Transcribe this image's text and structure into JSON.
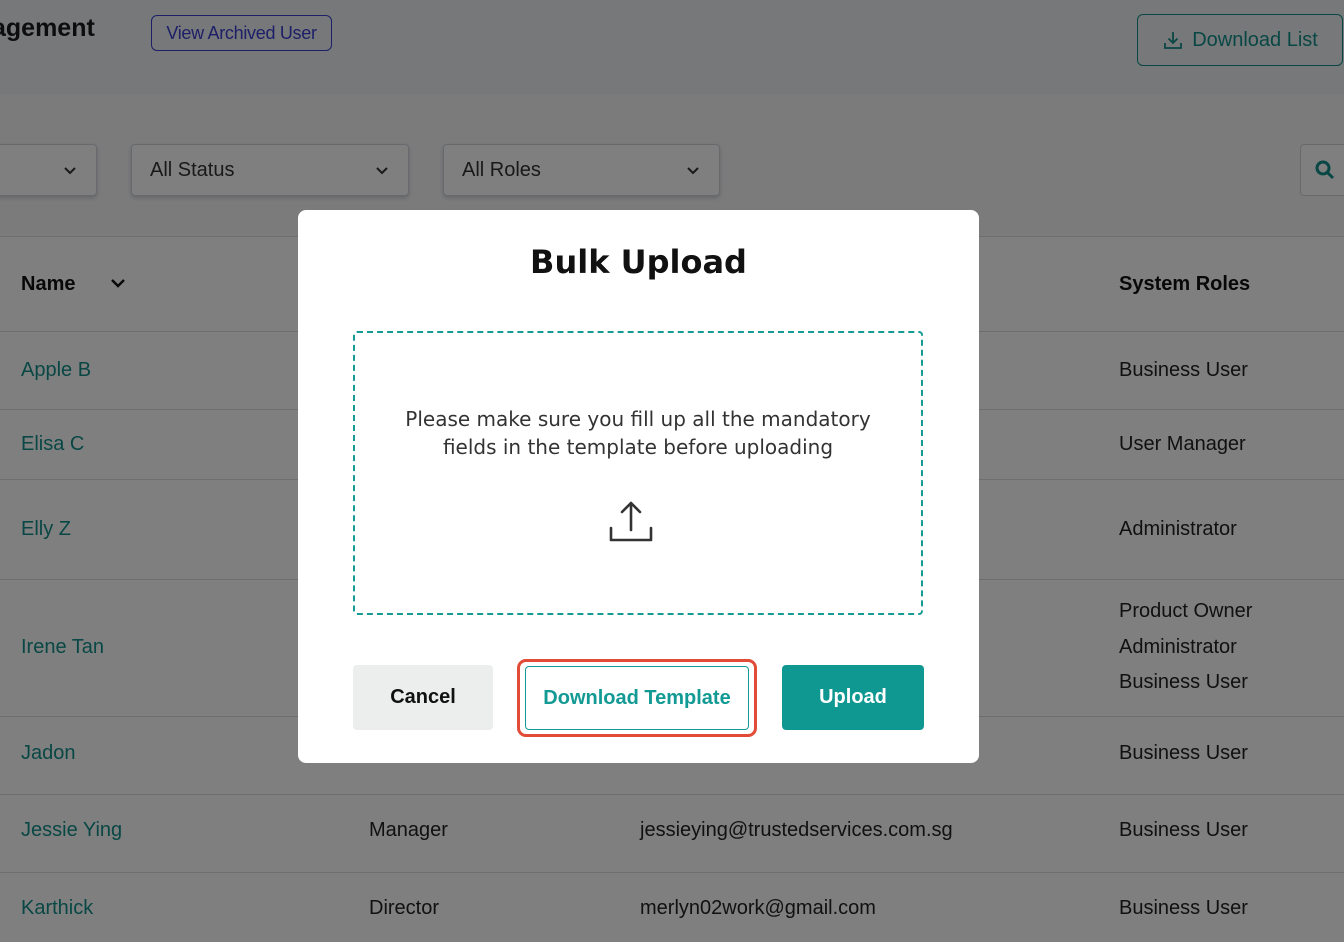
{
  "header": {
    "title_fragment": "agement",
    "view_archived_label": "View Archived User",
    "download_list_label": "Download List"
  },
  "filters": {
    "first_select_value": "",
    "status_select_value": "All Status",
    "roles_select_value": "All Roles"
  },
  "table": {
    "columns": {
      "name": "Name",
      "system_roles": "System Roles"
    },
    "rows": [
      {
        "name": "Apple B",
        "designation": "",
        "email": "",
        "roles": [
          "Business User"
        ]
      },
      {
        "name": "Elisa C",
        "designation": "",
        "email": "",
        "roles": [
          "User Manager"
        ]
      },
      {
        "name": "Elly Z",
        "designation": "",
        "email": "",
        "roles": [
          "Administrator"
        ]
      },
      {
        "name": "Irene Tan",
        "designation": "",
        "email": "",
        "roles": [
          "Product Owner",
          "Administrator",
          "Business User"
        ]
      },
      {
        "name": "Jadon",
        "designation": "",
        "email": "",
        "roles": [
          "Business User"
        ]
      },
      {
        "name": "Jessie Ying",
        "designation": "Manager",
        "email": "jessieying@trustedservices.com.sg",
        "roles": [
          "Business User"
        ]
      },
      {
        "name": "Karthick",
        "designation": "Director",
        "email": "merlyn02work@gmail.com",
        "roles": [
          "Business User"
        ]
      }
    ]
  },
  "modal": {
    "title": "Bulk Upload",
    "dropzone_text_line1": "Please make sure you fill up all the mandatory",
    "dropzone_text_line2": "fields in the template before uploading",
    "upload_icon": "upload-icon",
    "cancel_label": "Cancel",
    "download_template_label": "Download Template",
    "upload_label": "Upload"
  },
  "colors": {
    "accent_teal": "#0f9891",
    "archived_blue": "#3a3fd0",
    "highlight_red": "#e24b35"
  }
}
